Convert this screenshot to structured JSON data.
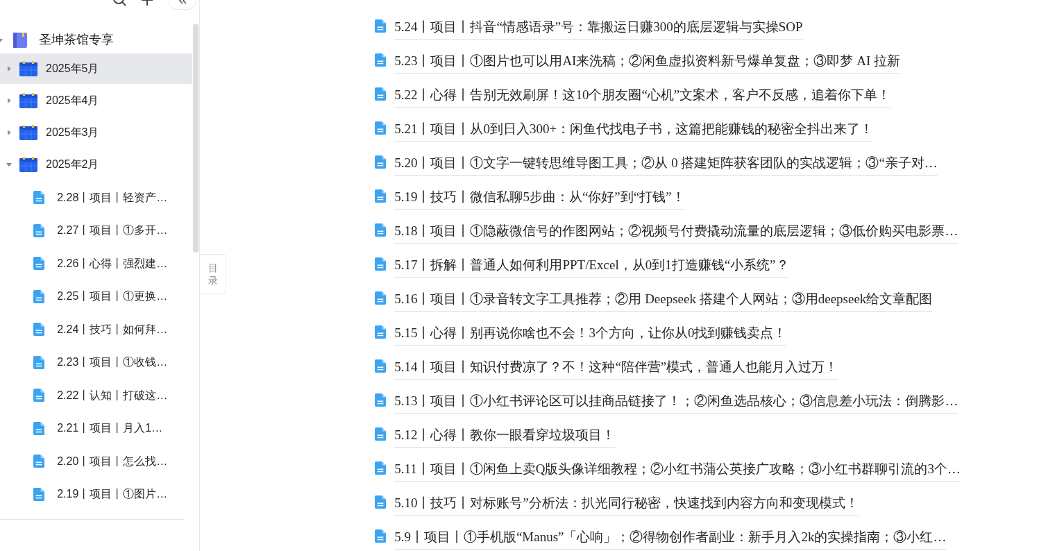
{
  "sidebar": {
    "tree": {
      "label": "圣坤茶馆专享",
      "expanded": true,
      "children": [
        {
          "label": "2025年5月",
          "expanded": false,
          "selected": true
        },
        {
          "label": "2025年4月",
          "expanded": false,
          "selected": false
        },
        {
          "label": "2025年3月",
          "expanded": false,
          "selected": false
        },
        {
          "label": "2025年2月",
          "expanded": true,
          "selected": false,
          "children": [
            {
              "label": "2.28丨项目丨轻资产…"
            },
            {
              "label": "2.27丨项目丨①多开…"
            },
            {
              "label": "2.26丨心得丨强烈建…"
            },
            {
              "label": "2.25丨项目丨①更换…"
            },
            {
              "label": "2.24丨技巧丨如何拜…"
            },
            {
              "label": "2.23丨项目丨①收钱…"
            },
            {
              "label": "2.22丨认知丨打破这…"
            },
            {
              "label": "2.21丨项目丨月入1…"
            },
            {
              "label": "2.20丨项目丨怎么找…"
            },
            {
              "label": "2.19丨项目丨①图片…"
            }
          ]
        }
      ]
    }
  },
  "toc_tab": "目录",
  "articles": [
    {
      "title": "5.24丨项目丨抖音“情感语录”号：靠搬运日赚300的底层逻辑与实操SOP"
    },
    {
      "title": "5.23丨项目丨①图片也可以用AI来洗稿；②闲鱼虚拟资料新号爆单复盘；③即梦 AI 拉新"
    },
    {
      "title": "5.22丨心得丨告别无效刷屏！这10个朋友圈“心机”文案术，客户不反感，追着你下单！"
    },
    {
      "title": "5.21丨项目丨从0到日入300+：闲鱼代找电子书，这篇把能赚钱的秘密全抖出来了！"
    },
    {
      "title": "5.20丨项目丨①文字一键转思维导图工具；②从 0 搭建矩阵获客团队的实战逻辑；③“亲子对…"
    },
    {
      "title": "5.19丨技巧丨微信私聊5步曲：从“你好”到“打钱”！"
    },
    {
      "title": "5.18丨项目丨①隐蔽微信号的作图网站；②视频号付费撬动流量的底层逻辑；③低价购买电影票…"
    },
    {
      "title": "5.17丨拆解丨普通人如何利用PPT/Excel，从0到1打造赚钱“小系统”？"
    },
    {
      "title": "5.16丨项目丨①录音转文字工具推荐；②用 Deepseek 搭建个人网站；③用deepseek给文章配图"
    },
    {
      "title": "5.15丨心得丨别再说你啥也不会！3个方向，让你从0找到赚钱卖点！"
    },
    {
      "title": "5.14丨项目丨知识付费凉了？不！这种“陪伴营”模式，普通人也能月入过万！"
    },
    {
      "title": "5.13丨项目丨①小红书评论区可以挂商品链接了！；②闲鱼选品核心；③信息差小玩法：倒腾影…"
    },
    {
      "title": "5.12丨心得丨教你一眼看穿垃圾项目！"
    },
    {
      "title": "5.11丨项目丨①闲鱼上卖Q版头像详细教程；②小红书蒲公英接广攻略；③小红书群聊引流的3个…"
    },
    {
      "title": "5.10丨技巧丨对标账号”分析法：扒光同行秘密，快速找到内容方向和变现模式！"
    },
    {
      "title": "5.9丨项目丨①手机版“Manus”「心响」；②得物创作者副业：新手月入2k的实操指南；③小红…"
    }
  ]
}
